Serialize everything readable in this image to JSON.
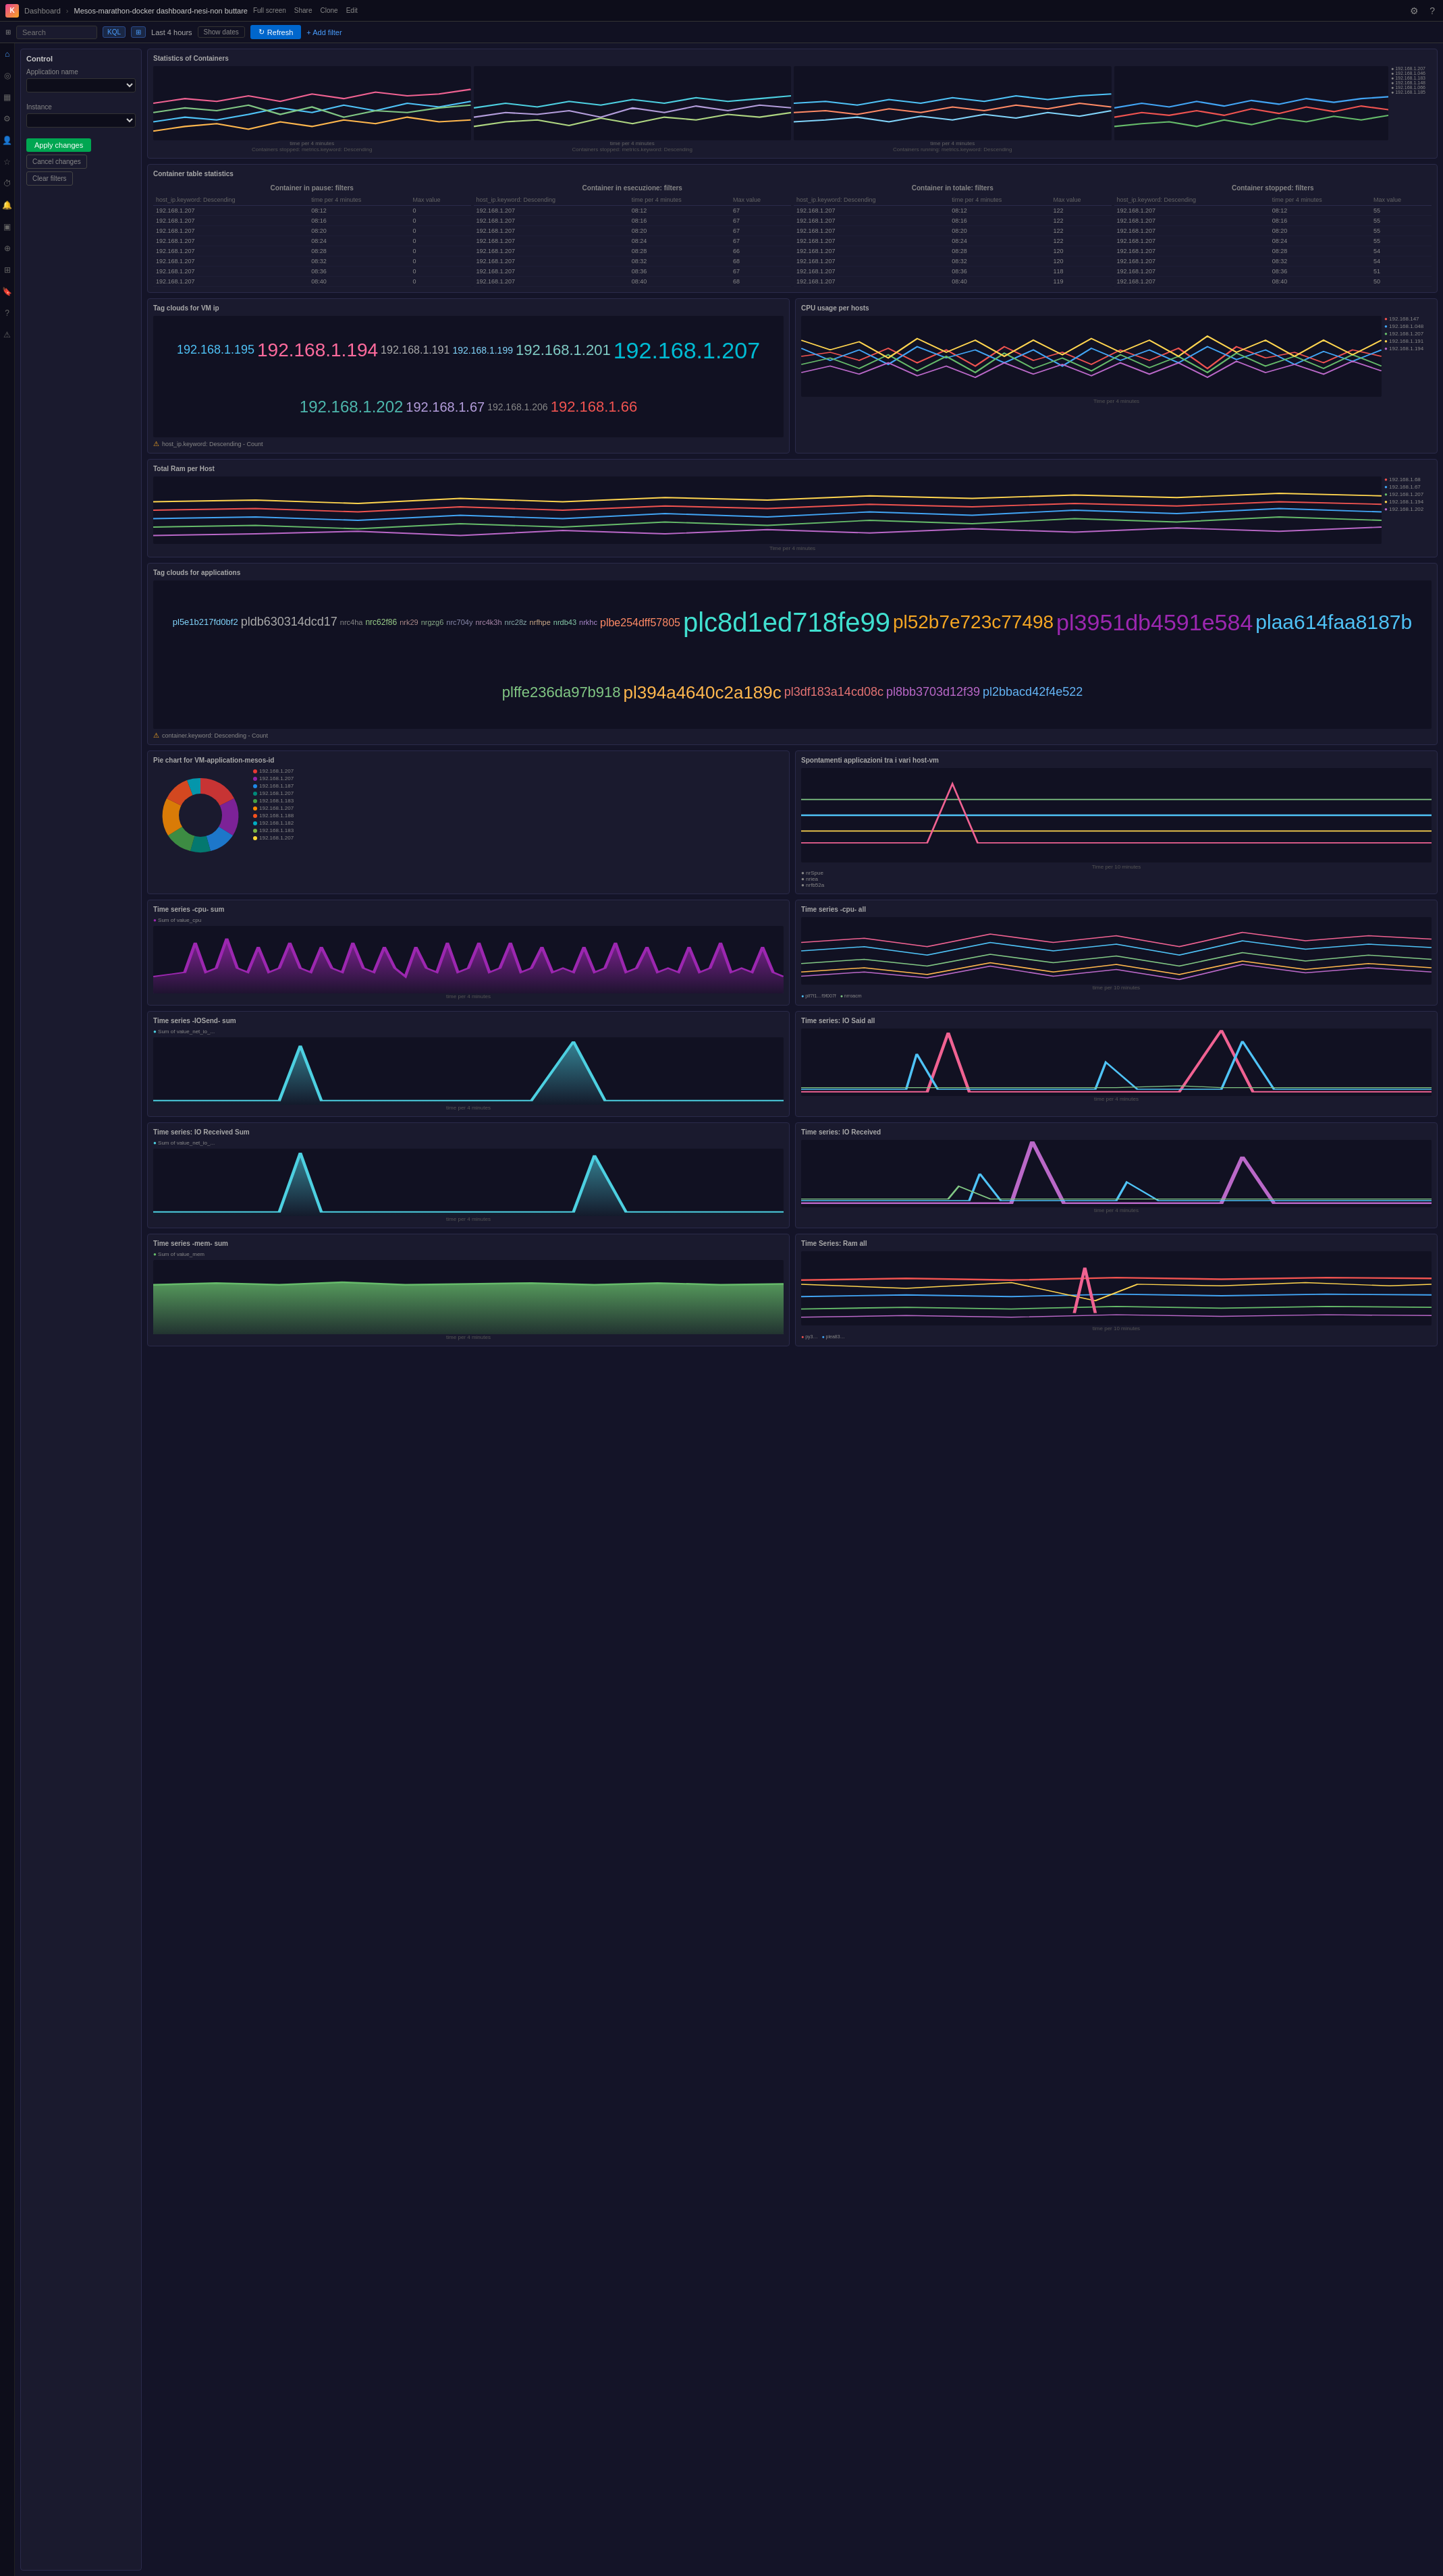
{
  "topbar": {
    "logo": "K",
    "breadcrumb": "Dashboard",
    "title": "Mesos-marathon-docker dashboard-nesi-non buttare",
    "actions": [
      "Full screen",
      "Share",
      "Clone",
      "Edit"
    ],
    "icons": [
      "gear",
      "help"
    ]
  },
  "filterbar": {
    "kql_label": "KQL",
    "time_selector": "⊞",
    "time_range": "Last 4 hours",
    "show_dates": "Show dates",
    "refresh": "Refresh",
    "search_placeholder": "Search",
    "add_filter": "+ Add filter"
  },
  "sidebar_icons": [
    "home",
    "compass",
    "chart",
    "settings",
    "user",
    "star",
    "clock",
    "bell",
    "layers",
    "map",
    "grid",
    "bookmark",
    "help",
    "alert"
  ],
  "control": {
    "title": "Control",
    "app_name_label": "Application name",
    "instance_label": "Instance",
    "apply_btn": "Apply changes",
    "cancel_btn": "Cancel changes",
    "clear_btn": "Clear filters"
  },
  "stats_title": "Statistics of Containers",
  "container_table_title": "Container table statistics",
  "table_sections": [
    "Container in pause: filters",
    "Container in esecuzione: filters",
    "Container in totale: filters",
    "Container stopped: filters"
  ],
  "table_cols": [
    "host_ip.keyword: Descending",
    "time per 4 minutes",
    "Max value"
  ],
  "table_rows": [
    [
      "192.168.1.207",
      "08:12",
      "0"
    ],
    [
      "192.168.1.207",
      "08:16",
      "0"
    ],
    [
      "192.168.1.207",
      "08:20",
      "0"
    ],
    [
      "192.168.1.207",
      "08:24",
      "0"
    ],
    [
      "192.168.1.207",
      "08:28",
      "0"
    ],
    [
      "192.168.1.207",
      "08:32",
      "0"
    ],
    [
      "192.168.1.207",
      "08:36",
      "0"
    ],
    [
      "192.168.1.207",
      "08:40",
      "0"
    ]
  ],
  "table_rows2": [
    [
      "192.168.1.207",
      "08:12",
      "67"
    ],
    [
      "192.168.1.207",
      "08:16",
      "67"
    ],
    [
      "192.168.1.207",
      "08:20",
      "67"
    ],
    [
      "192.168.1.207",
      "08:24",
      "67"
    ],
    [
      "192.168.1.207",
      "08:28",
      "66"
    ],
    [
      "192.168.1.207",
      "08:32",
      "68"
    ],
    [
      "192.168.1.207",
      "08:36",
      "67"
    ],
    [
      "192.168.1.207",
      "08:40",
      "68"
    ]
  ],
  "table_rows3": [
    [
      "192.168.1.207",
      "08:12",
      "122"
    ],
    [
      "192.168.1.207",
      "08:16",
      "122"
    ],
    [
      "192.168.1.207",
      "08:20",
      "122"
    ],
    [
      "192.168.1.207",
      "08:24",
      "122"
    ],
    [
      "192.168.1.207",
      "08:28",
      "120"
    ],
    [
      "192.168.1.207",
      "08:32",
      "120"
    ],
    [
      "192.168.1.207",
      "08:36",
      "118"
    ],
    [
      "192.168.1.207",
      "08:40",
      "119"
    ]
  ],
  "table_rows4": [
    [
      "192.168.1.207",
      "08:12",
      "55"
    ],
    [
      "192.168.1.207",
      "08:16",
      "55"
    ],
    [
      "192.168.1.207",
      "08:20",
      "55"
    ],
    [
      "192.168.1.207",
      "08:24",
      "55"
    ],
    [
      "192.168.1.207",
      "08:28",
      "54"
    ],
    [
      "192.168.1.207",
      "08:32",
      "54"
    ],
    [
      "192.168.1.207",
      "08:36",
      "51"
    ],
    [
      "192.168.1.207",
      "08:40",
      "50"
    ]
  ],
  "tag_cloud_vm": {
    "title": "Tag clouds for VM ip",
    "tags": [
      {
        "text": "192.168.1.195",
        "size": 18,
        "color": "#4fc3f7"
      },
      {
        "text": "192.168.1.194",
        "size": 28,
        "color": "#ff6b9d"
      },
      {
        "text": "192.168.1.191",
        "size": 16,
        "color": "#aaa"
      },
      {
        "text": "192.168.1.199",
        "size": 14,
        "color": "#81d4fa"
      },
      {
        "text": "192.168.1.201",
        "size": 22,
        "color": "#80cbc4"
      },
      {
        "text": "192.168.1.207",
        "size": 34,
        "color": "#00bcd4"
      },
      {
        "text": "192.168.1.202",
        "size": 24,
        "color": "#4db6ac"
      },
      {
        "text": "192.168.1.67",
        "size": 20,
        "color": "#b39ddb"
      },
      {
        "text": "192.168.1.206",
        "size": 14,
        "color": "#888"
      },
      {
        "text": "192.168.1.66",
        "size": 22,
        "color": "#ef5350"
      }
    ]
  },
  "cpu_chart_title": "CPU usage per hosts",
  "cpu_legend": [
    "192.168.147",
    "192.168.1.048",
    "192.168.1.207",
    "192.168.1.207",
    "192.168.1.194",
    "192.168.1.191"
  ],
  "ram_chart_title": "Total Ram per Host",
  "ram_legend": [
    "192.168.1.68",
    "192.168.1.67",
    "192.168.1.207",
    "192.168.1.207",
    "192.168.1.194",
    "192.168.1.202"
  ],
  "tag_cloud_apps": {
    "title": "Tag clouds for applications",
    "subtitle": "container.keyword: Descending - Count",
    "tags": [
      {
        "text": "pl5e1b217fd0bf2",
        "size": 13,
        "color": "#81d4fa"
      },
      {
        "text": "pldb630314dcd17",
        "size": 18,
        "color": "#aaa"
      },
      {
        "text": "nrc4ha",
        "size": 11,
        "color": "#888"
      },
      {
        "text": "nrc62f86",
        "size": 12,
        "color": "#9c8"
      },
      {
        "text": "nrk29",
        "size": 11,
        "color": "#a88"
      },
      {
        "text": "nrgzg6",
        "size": 11,
        "color": "#8a8"
      },
      {
        "text": "nrc704y",
        "size": 11,
        "color": "#88a"
      },
      {
        "text": "nrc4k3h",
        "size": 11,
        "color": "#a8a"
      },
      {
        "text": "nrc28z",
        "size": 11,
        "color": "#8aa"
      },
      {
        "text": "nrfhpe",
        "size": 11,
        "color": "#ca8"
      },
      {
        "text": "nrdb43",
        "size": 11,
        "color": "#8ca"
      },
      {
        "text": "nrkhc",
        "size": 11,
        "color": "#a8c"
      },
      {
        "text": "plbe254dff57805",
        "size": 16,
        "color": "#ff8a65"
      },
      {
        "text": "plc8d1ed718fe99",
        "size": 40,
        "color": "#40e0d0"
      },
      {
        "text": "pl52b7e723c77498",
        "size": 28,
        "color": "#f5a623"
      },
      {
        "text": "pl3951db4591e584",
        "size": 34,
        "color": "#9c27b0"
      },
      {
        "text": "plaa614faa8187b",
        "size": 30,
        "color": "#4fc3f7"
      },
      {
        "text": "plffe236da97b918",
        "size": 22,
        "color": "#81c784"
      },
      {
        "text": "pl394a4640c2a189c",
        "size": 26,
        "color": "#ffb74d"
      },
      {
        "text": "pl3df183a14cd08c",
        "size": 18,
        "color": "#e57373"
      },
      {
        "text": "pl8bb3703d12f39",
        "size": 18,
        "color": "#ba68c8"
      },
      {
        "text": "pl2bbacd42f4e522",
        "size": 18,
        "color": "#64b5f6"
      }
    ]
  },
  "pie_chart_title": "Pie chart for VM-application-mesos-id",
  "pie_legend": [
    {
      "color": "#e53935",
      "label": "192.168.1.207"
    },
    {
      "color": "#8e24aa",
      "label": "192.168.1.207"
    },
    {
      "color": "#1e88e5",
      "label": "192.168.1.187"
    },
    {
      "color": "#00897b",
      "label": "192.168.1.207"
    },
    {
      "color": "#43a047",
      "label": "192.168.1.183"
    },
    {
      "color": "#fb8c00",
      "label": "192.168.1.207"
    },
    {
      "color": "#f4511e",
      "label": "192.168.1.188"
    },
    {
      "color": "#00acc1",
      "label": "192.168.1.182"
    },
    {
      "color": "#7cb342",
      "label": "192.168.1.183"
    },
    {
      "color": "#fdd835",
      "label": "192.168.1.207"
    }
  ],
  "spontaneous_title": "Spontamenti applicazioni tra i vari host-vm",
  "ts_cpu_sum_title": "Time series -cpu- sum",
  "ts_cpu_sum_legend": "Sum of value_cpu",
  "ts_cpu_all_title": "Time series -cpu- all",
  "ts_iosend_sum_title": "Time series -IOSend- sum",
  "ts_iosend_sum_legend": "Sum of value_net_io_...",
  "ts_iosend_all_title": "Time series: IO Said all",
  "ts_ioreceived_sum_title": "Time series: IO Received Sum",
  "ts_ioreceived_sum_legend": "Sum of value_net_io_...",
  "ts_ioreceived_all_title": "Time series: IO Received",
  "ts_mem_sum_title": "Time series -mem- sum",
  "ts_mem_sum_legend": "Sum of value_mem",
  "ts_mem_all_title": "Time Series: Ram all",
  "warning_text": "host_ip.keyword: Descending - Count",
  "warning_text2": "container.keyword: Descending - Count"
}
